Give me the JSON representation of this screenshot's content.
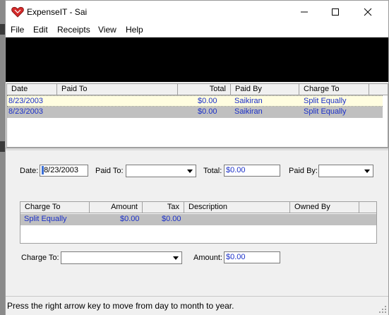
{
  "window": {
    "title": "ExpenseIT - Sai"
  },
  "menu": [
    "File",
    "Edit",
    "Receipts",
    "View",
    "Help"
  ],
  "grid": {
    "columns": [
      "Date",
      "Paid To",
      "Total",
      "Paid By",
      "Charge To"
    ],
    "rows": [
      {
        "date": "8/23/2003",
        "paid_to": "",
        "total": "$0.00",
        "paid_by": "Saikiran",
        "charge_to": "Split Equally"
      },
      {
        "date": "8/23/2003",
        "paid_to": "",
        "total": "$0.00",
        "paid_by": "Saikiran",
        "charge_to": "Split Equally"
      }
    ]
  },
  "form": {
    "date_label": "Date:",
    "date_value": "8/23/2003",
    "paid_to_label": "Paid To:",
    "paid_to_value": "",
    "total_label": "Total:",
    "total_value": "$0.00",
    "paid_by_label": "Paid By:",
    "paid_by_value": ""
  },
  "items": {
    "columns": [
      "Charge To",
      "Amount",
      "Tax",
      "Description",
      "Owned By"
    ],
    "rows": [
      {
        "charge_to": "Split Equally",
        "amount": "$0.00",
        "tax": "$0.00",
        "description": "",
        "owned_by": ""
      }
    ]
  },
  "item_form": {
    "charge_to_label": "Charge To:",
    "charge_to_value": "",
    "amount_label": "Amount:",
    "amount_value": "$0.00"
  },
  "status": {
    "text": "Press the right arrow key to move from day to month to year."
  },
  "colors": {
    "row_selected": "#fffde0",
    "row_alt": "#c0c0c0",
    "data_text": "#1a2fc8",
    "background": "#f0f0f0"
  }
}
